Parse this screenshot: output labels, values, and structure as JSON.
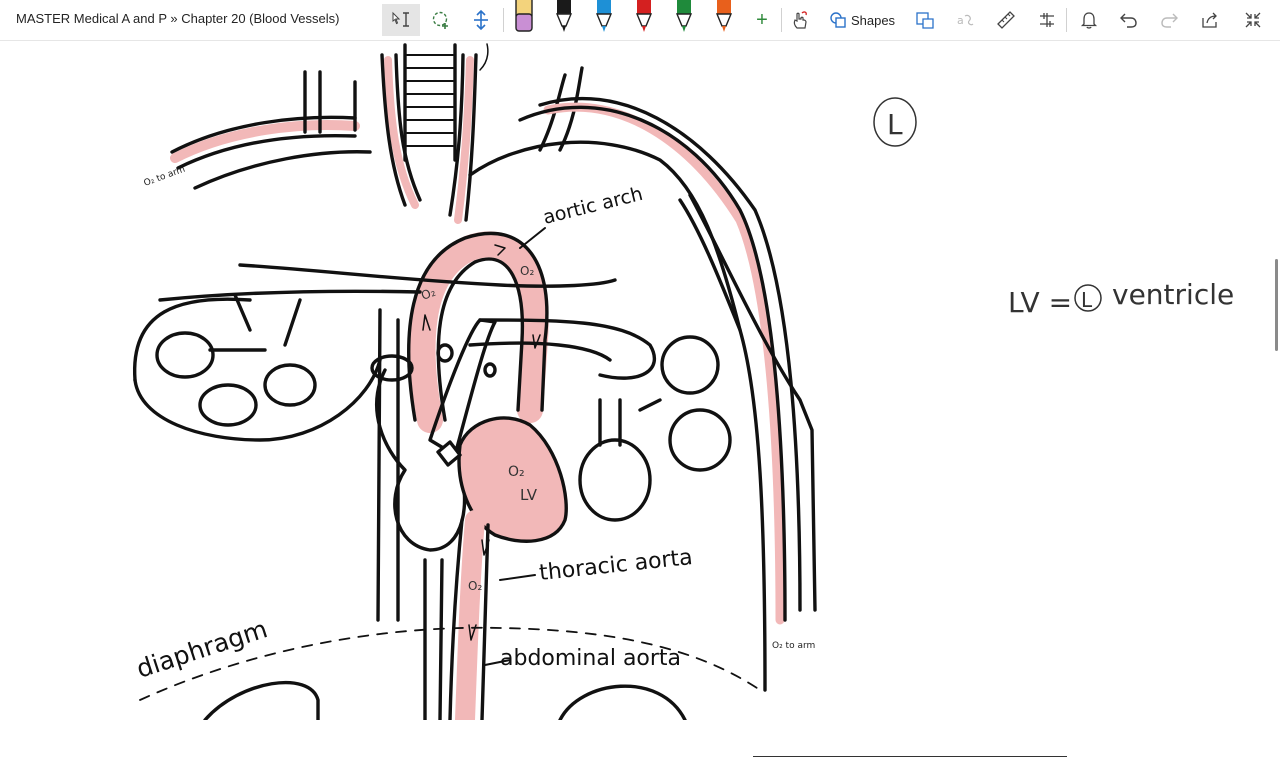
{
  "app": {
    "breadcrumb": "MASTER Medical A and P » Chapter 20 (Blood Vessels)"
  },
  "toolbar": {
    "tools": [
      {
        "name": "select-text-tool",
        "icon": "text-cursor-icon",
        "active": true
      },
      {
        "name": "lasso-select-tool",
        "icon": "lasso-icon"
      },
      {
        "name": "insert-space-tool",
        "icon": "add-space-icon"
      },
      {
        "name": "eraser-tool",
        "icon": "eraser-icon"
      },
      {
        "name": "pen-black",
        "icon": "pen-icon",
        "color": "#1a1a1a"
      },
      {
        "name": "pen-blue",
        "icon": "pen-icon",
        "color": "#1e90d6"
      },
      {
        "name": "pen-red",
        "icon": "pen-icon",
        "color": "#d42020"
      },
      {
        "name": "pen-green",
        "icon": "pen-icon",
        "color": "#1f8a3b"
      },
      {
        "name": "pen-orange",
        "icon": "pen-icon",
        "color": "#e8601c"
      }
    ],
    "eraser_color": "#c98fd4",
    "eraser_top_color": "#f3d37c",
    "add_pen": "+",
    "shapes_label": "Shapes"
  },
  "drawing": {
    "labels": {
      "o2_arm_left": "O₂ to arm",
      "o2_arm_right": "O₂ to arm",
      "aortic_arch": "aortic arch",
      "o2_arch": "O₂",
      "o2_left_arch": "O₂",
      "o2_heart": "O₂",
      "lv_heart": "LV",
      "thoracic_aorta": "thoracic aorta",
      "o2_thoracic": "O₂",
      "abdominal_aorta": "abdominal aorta",
      "diaphragm": "diaphragm",
      "circle_l": "L",
      "lv_note_prefix": "LV =",
      "lv_note_l": "L",
      "lv_note_word": "ventricle"
    },
    "colors": {
      "ink": "#111111",
      "oxygenated": "#f2b8b8",
      "oxygenated_edge": "#c96f6f"
    }
  }
}
